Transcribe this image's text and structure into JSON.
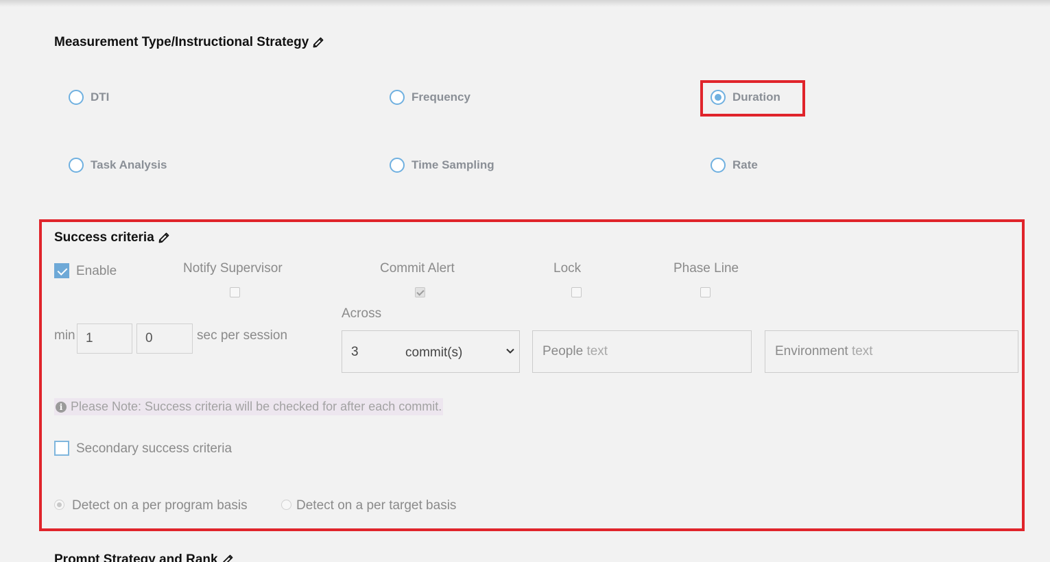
{
  "measurement": {
    "title": "Measurement Type/Instructional Strategy",
    "options": [
      {
        "label": "DTI",
        "checked": false
      },
      {
        "label": "Frequency",
        "checked": false
      },
      {
        "label": "Duration",
        "checked": true
      },
      {
        "label": "Task Analysis",
        "checked": false
      },
      {
        "label": "Time Sampling",
        "checked": false
      },
      {
        "label": "Rate",
        "checked": false
      }
    ]
  },
  "success": {
    "title": "Success criteria",
    "enable_label": "Enable",
    "enable_checked": true,
    "notify_supervisor_label": "Notify Supervisor",
    "commit_alert_label": "Commit Alert",
    "lock_label": "Lock",
    "phase_line_label": "Phase Line",
    "min_label": "min",
    "min_value": "1",
    "sec_value": "0",
    "per_session_label": "sec per session",
    "across_label": "Across",
    "across_value": "3",
    "across_unit": "commit(s)",
    "people_label": "People",
    "people_placeholder": "text",
    "environment_label": "Environment",
    "environment_placeholder": "text",
    "note": "Please Note: Success criteria will be checked for after each commit.",
    "secondary_label": "Secondary success criteria",
    "detect_program_label": "Detect on a per program basis",
    "detect_target_label": "Detect on a per target basis"
  },
  "prompt": {
    "title": "Prompt Strategy and Rank"
  },
  "colors": {
    "highlight": "#e0242b",
    "radio_accent": "#6fb0e0"
  }
}
